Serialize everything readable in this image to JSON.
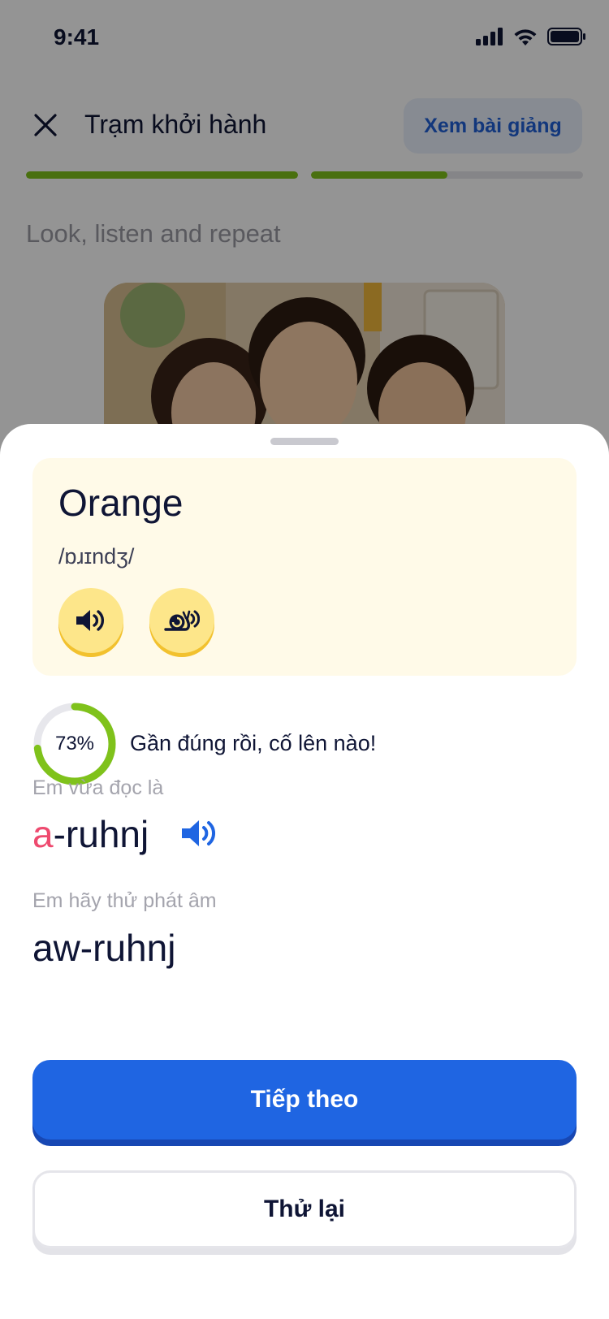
{
  "status_bar": {
    "time": "9:41"
  },
  "header": {
    "title": "Trạm khởi hành",
    "lecture_button": "Xem bài giảng"
  },
  "progress": {
    "segments": [
      1.0,
      0.5
    ]
  },
  "instruction": "Look, listen and repeat",
  "sheet": {
    "word": "Orange",
    "ipa": "/ɒɹɪndʒ/",
    "audio_buttons": [
      "speaker-icon",
      "snail-slow-icon"
    ],
    "score": {
      "percent": 73,
      "label": "73%"
    },
    "feedback": "Gần đúng rồi, cố lên nào!",
    "you_read_label": "Em vừa đọc là",
    "you_read": {
      "error_part": "a",
      "rest": "-ruhnj"
    },
    "try_label": "Em hãy thử phát âm",
    "try_word": "aw-ruhnj",
    "next_button": "Tiếp theo",
    "retry_button": "Thử lại"
  },
  "colors": {
    "accent_blue": "#1f65e2",
    "progress_green": "#7fc21b",
    "error_red": "#ee4a6f",
    "card_yellow": "#fffae8"
  }
}
